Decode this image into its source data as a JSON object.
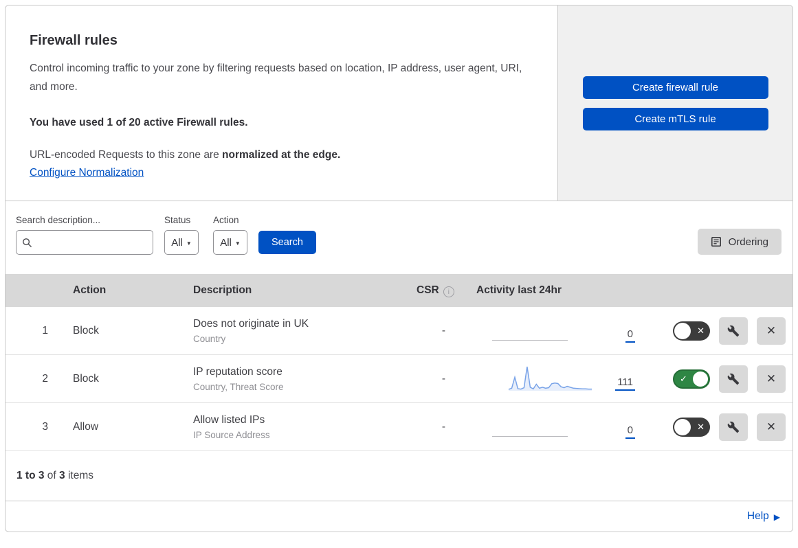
{
  "colors": {
    "accent_blue": "#0051c3",
    "toggle_on_green": "#2e8644",
    "toggle_off_gray": "#3c3c3c",
    "sparkline_blue": "#79a3e8",
    "panel_gray": "#f0f0f0"
  },
  "icons": {
    "caret_down": "▼",
    "close": "✕",
    "check": "✓",
    "help_arrow": "▶",
    "info": "i"
  },
  "overview": {
    "title": "Firewall rules",
    "description": "Control incoming traffic to your zone by filtering requests based on location, IP address, user agent, URI, and more.",
    "usage_notice": "You have used 1 of 20 active Firewall rules.",
    "normalization_text": "URL-encoded Requests to this zone are ",
    "normalization_bold": "normalized at the edge.",
    "normalization_link": "Configure Normalization",
    "create_firewall_button": "Create firewall rule",
    "create_mtls_button": "Create mTLS rule"
  },
  "filters": {
    "search_label": "Search description...",
    "status_label": "Status",
    "status_value": "All",
    "action_label": "Action",
    "action_value": "All",
    "search_button": "Search",
    "ordering_button": "Ordering"
  },
  "table": {
    "headers": {
      "action": "Action",
      "description": "Description",
      "csr": "CSR",
      "activity": "Activity last 24hr"
    },
    "rows": [
      {
        "num": "1",
        "action": "Block",
        "description": "Does not originate in UK",
        "fields": "Country",
        "csr": "-",
        "count": "0",
        "enabled": false,
        "sparkline": null
      },
      {
        "num": "2",
        "action": "Block",
        "description": "IP reputation score",
        "fields": "Country, Threat Score",
        "csr": "-",
        "count": "111",
        "enabled": true,
        "sparkline": [
          3,
          8,
          55,
          6,
          4,
          10,
          100,
          12,
          5,
          25,
          8,
          12,
          8,
          10,
          27,
          30,
          28,
          14,
          10,
          16,
          12,
          8,
          7,
          6,
          5,
          5,
          4,
          4
        ]
      },
      {
        "num": "3",
        "action": "Allow",
        "description": "Allow listed IPs",
        "fields": "IP Source Address",
        "csr": "-",
        "count": "0",
        "enabled": false,
        "sparkline": null
      }
    ]
  },
  "footer": {
    "range_bold": "1 to 3",
    "of_text": " of ",
    "total_bold": "3",
    "items_text": " items"
  },
  "help": {
    "label": "Help"
  }
}
